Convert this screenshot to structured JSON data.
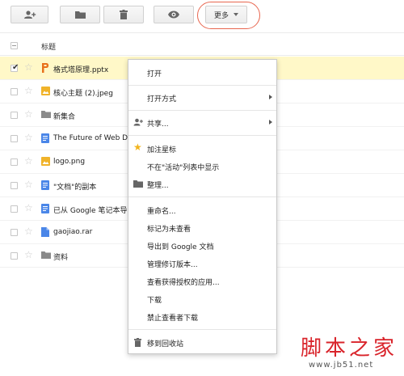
{
  "toolbar": {
    "add_user_icon": "add-person-icon",
    "folder_icon": "folder-icon",
    "delete_icon": "trash-icon",
    "preview_icon": "eye-icon",
    "more_label": "更多"
  },
  "header": {
    "title_label": "标题"
  },
  "files": [
    {
      "name": "格式塔原理.pptx",
      "type": "pptx",
      "selected": true,
      "icon": "presentation-icon",
      "color": "#e8711c"
    },
    {
      "name": "核心主题 (2).jpeg",
      "type": "image",
      "selected": false,
      "icon": "image-icon",
      "color": "#f0b32a"
    },
    {
      "name": "新集合",
      "type": "folder",
      "selected": false,
      "icon": "folder-icon",
      "color": "#8a8a8a"
    },
    {
      "name": "The Future of Web De",
      "type": "doc",
      "selected": false,
      "icon": "document-icon",
      "color": "#4a86e8"
    },
    {
      "name": "logo.png",
      "type": "image",
      "selected": false,
      "icon": "image-icon",
      "color": "#f0b32a"
    },
    {
      "name": "\"文档\"的副本",
      "type": "doc",
      "selected": false,
      "icon": "document-icon",
      "color": "#4a86e8"
    },
    {
      "name": "已从 Google 笔记本导",
      "type": "doc",
      "selected": false,
      "icon": "document-icon",
      "color": "#4a86e8"
    },
    {
      "name": "gaojiao.rar",
      "type": "file",
      "selected": false,
      "icon": "file-icon",
      "color": "#4a86e8"
    },
    {
      "name": "资料",
      "type": "folder",
      "selected": false,
      "icon": "folder-icon",
      "color": "#8a8a8a"
    }
  ],
  "menu": {
    "open": "打开",
    "open_with": "打开方式",
    "share": "共享...",
    "star": "加注星标",
    "hide_activity": "不在\"活动\"列表中显示",
    "organize": "整理...",
    "rename": "重命名...",
    "mark_unviewed": "标记为未查看",
    "export_docs": "导出到 Google 文档",
    "manage_revisions": "管理修订版本...",
    "view_apps": "查看获得授权的应用...",
    "download": "下载",
    "disable_download": "禁止查看者下载",
    "move_trash": "移到回收站"
  },
  "watermark": {
    "brand": "脚本之家",
    "url": "www.jb51.net"
  },
  "colors": {
    "selected_row": "#fff8c8",
    "highlight_ring": "#e8664f",
    "star": "#f2b41c"
  }
}
